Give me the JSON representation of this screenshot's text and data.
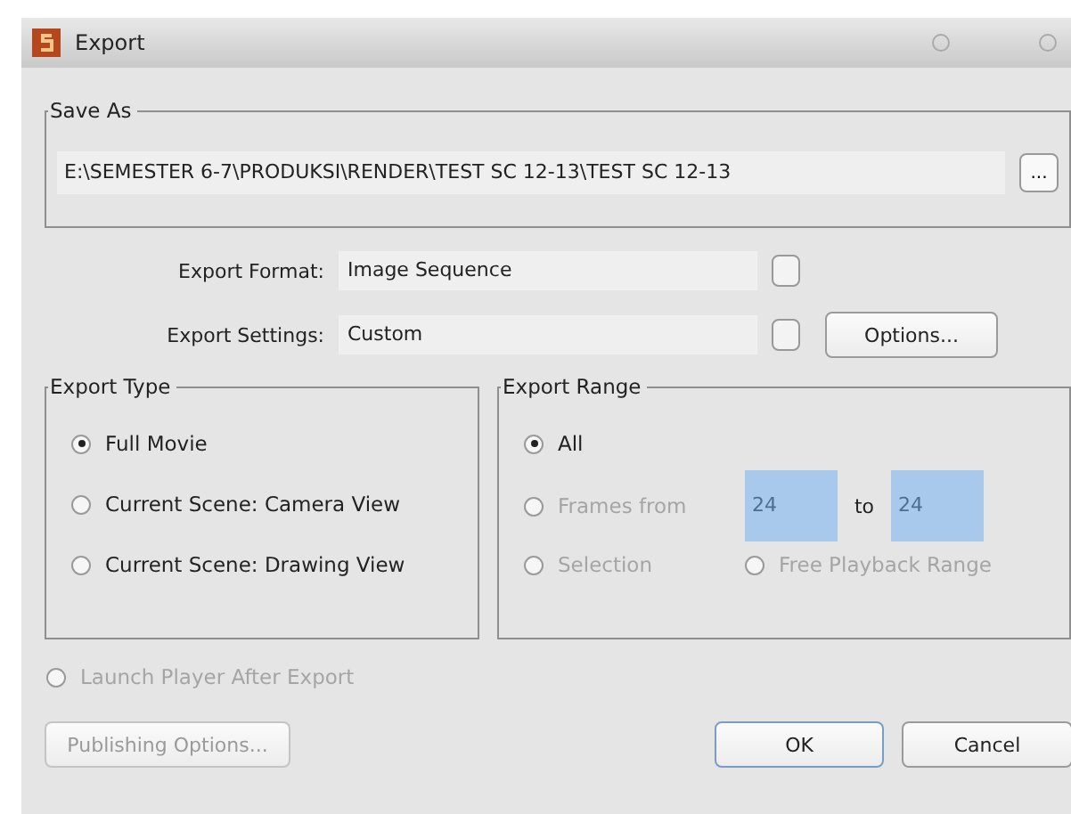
{
  "window": {
    "title": "Export"
  },
  "save_as": {
    "title": "Save As",
    "path": "E:\\SEMESTER 6-7\\PRODUKSI\\RENDER\\TEST SC 12-13\\TEST SC 12-13",
    "browse_button": "..."
  },
  "export_format": {
    "label": "Export Format:",
    "value": "Image Sequence"
  },
  "export_settings": {
    "label": "Export Settings:",
    "value": "Custom",
    "options_button": "Options..."
  },
  "export_type": {
    "title": "Export Type",
    "options": [
      {
        "label": "Full Movie",
        "selected": true
      },
      {
        "label": "Current Scene: Camera View",
        "selected": false
      },
      {
        "label": "Current Scene: Drawing View",
        "selected": false
      }
    ]
  },
  "export_range": {
    "title": "Export Range",
    "all": {
      "label": "All",
      "selected": true,
      "disabled": false
    },
    "frames": {
      "label": "Frames from",
      "selected": false,
      "disabled": true,
      "from": "24",
      "to_label": "to",
      "to": "24"
    },
    "selection": {
      "label": "Selection",
      "selected": false,
      "disabled": true
    },
    "free_playback": {
      "label": "Free Playback Range",
      "selected": false,
      "disabled": true
    }
  },
  "launch_player": {
    "label": "Launch Player After Export",
    "checked": false,
    "disabled": true
  },
  "buttons": [
    {
      "label": "Publishing Options...",
      "kind": "left",
      "disabled": true
    },
    {
      "label": "OK",
      "kind": "default",
      "disabled": false
    },
    {
      "label": "Cancel",
      "kind": "normal",
      "disabled": false
    }
  ]
}
